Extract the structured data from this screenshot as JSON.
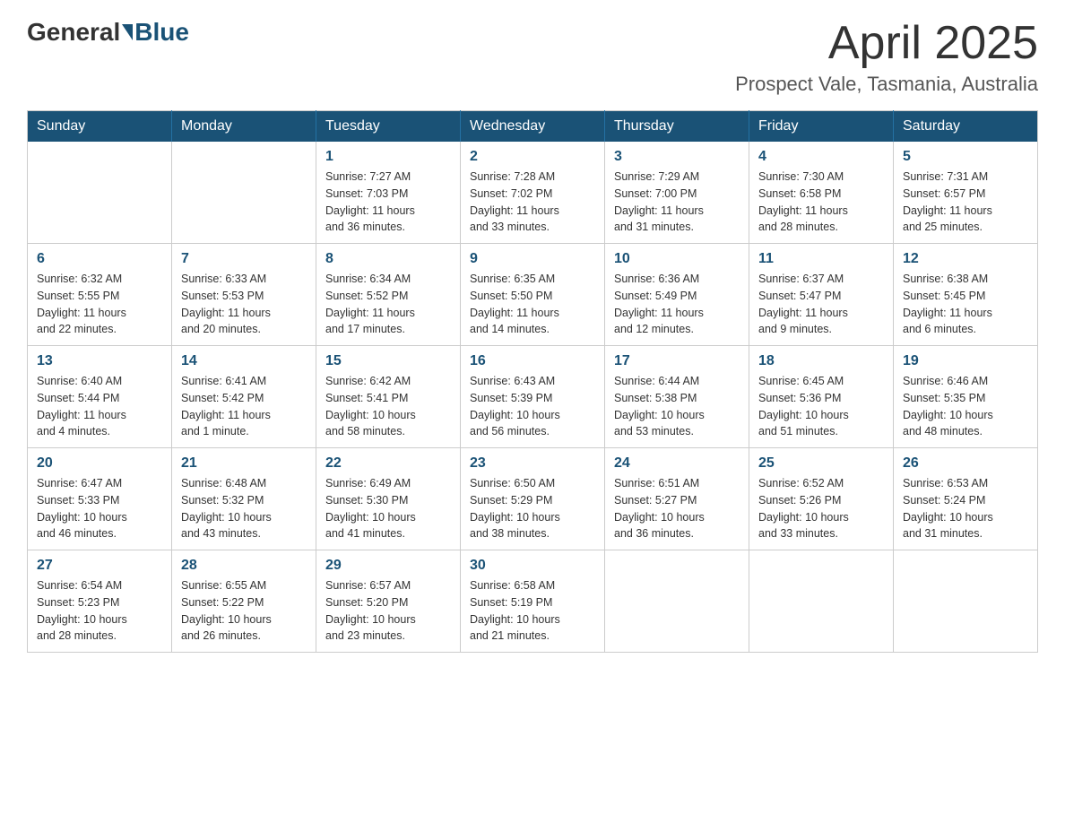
{
  "header": {
    "logo_general": "General",
    "logo_blue": "Blue",
    "month_title": "April 2025",
    "location": "Prospect Vale, Tasmania, Australia"
  },
  "days_of_week": [
    "Sunday",
    "Monday",
    "Tuesday",
    "Wednesday",
    "Thursday",
    "Friday",
    "Saturday"
  ],
  "weeks": [
    [
      {
        "day": "",
        "info": ""
      },
      {
        "day": "",
        "info": ""
      },
      {
        "day": "1",
        "info": "Sunrise: 7:27 AM\nSunset: 7:03 PM\nDaylight: 11 hours\nand 36 minutes."
      },
      {
        "day": "2",
        "info": "Sunrise: 7:28 AM\nSunset: 7:02 PM\nDaylight: 11 hours\nand 33 minutes."
      },
      {
        "day": "3",
        "info": "Sunrise: 7:29 AM\nSunset: 7:00 PM\nDaylight: 11 hours\nand 31 minutes."
      },
      {
        "day": "4",
        "info": "Sunrise: 7:30 AM\nSunset: 6:58 PM\nDaylight: 11 hours\nand 28 minutes."
      },
      {
        "day": "5",
        "info": "Sunrise: 7:31 AM\nSunset: 6:57 PM\nDaylight: 11 hours\nand 25 minutes."
      }
    ],
    [
      {
        "day": "6",
        "info": "Sunrise: 6:32 AM\nSunset: 5:55 PM\nDaylight: 11 hours\nand 22 minutes."
      },
      {
        "day": "7",
        "info": "Sunrise: 6:33 AM\nSunset: 5:53 PM\nDaylight: 11 hours\nand 20 minutes."
      },
      {
        "day": "8",
        "info": "Sunrise: 6:34 AM\nSunset: 5:52 PM\nDaylight: 11 hours\nand 17 minutes."
      },
      {
        "day": "9",
        "info": "Sunrise: 6:35 AM\nSunset: 5:50 PM\nDaylight: 11 hours\nand 14 minutes."
      },
      {
        "day": "10",
        "info": "Sunrise: 6:36 AM\nSunset: 5:49 PM\nDaylight: 11 hours\nand 12 minutes."
      },
      {
        "day": "11",
        "info": "Sunrise: 6:37 AM\nSunset: 5:47 PM\nDaylight: 11 hours\nand 9 minutes."
      },
      {
        "day": "12",
        "info": "Sunrise: 6:38 AM\nSunset: 5:45 PM\nDaylight: 11 hours\nand 6 minutes."
      }
    ],
    [
      {
        "day": "13",
        "info": "Sunrise: 6:40 AM\nSunset: 5:44 PM\nDaylight: 11 hours\nand 4 minutes."
      },
      {
        "day": "14",
        "info": "Sunrise: 6:41 AM\nSunset: 5:42 PM\nDaylight: 11 hours\nand 1 minute."
      },
      {
        "day": "15",
        "info": "Sunrise: 6:42 AM\nSunset: 5:41 PM\nDaylight: 10 hours\nand 58 minutes."
      },
      {
        "day": "16",
        "info": "Sunrise: 6:43 AM\nSunset: 5:39 PM\nDaylight: 10 hours\nand 56 minutes."
      },
      {
        "day": "17",
        "info": "Sunrise: 6:44 AM\nSunset: 5:38 PM\nDaylight: 10 hours\nand 53 minutes."
      },
      {
        "day": "18",
        "info": "Sunrise: 6:45 AM\nSunset: 5:36 PM\nDaylight: 10 hours\nand 51 minutes."
      },
      {
        "day": "19",
        "info": "Sunrise: 6:46 AM\nSunset: 5:35 PM\nDaylight: 10 hours\nand 48 minutes."
      }
    ],
    [
      {
        "day": "20",
        "info": "Sunrise: 6:47 AM\nSunset: 5:33 PM\nDaylight: 10 hours\nand 46 minutes."
      },
      {
        "day": "21",
        "info": "Sunrise: 6:48 AM\nSunset: 5:32 PM\nDaylight: 10 hours\nand 43 minutes."
      },
      {
        "day": "22",
        "info": "Sunrise: 6:49 AM\nSunset: 5:30 PM\nDaylight: 10 hours\nand 41 minutes."
      },
      {
        "day": "23",
        "info": "Sunrise: 6:50 AM\nSunset: 5:29 PM\nDaylight: 10 hours\nand 38 minutes."
      },
      {
        "day": "24",
        "info": "Sunrise: 6:51 AM\nSunset: 5:27 PM\nDaylight: 10 hours\nand 36 minutes."
      },
      {
        "day": "25",
        "info": "Sunrise: 6:52 AM\nSunset: 5:26 PM\nDaylight: 10 hours\nand 33 minutes."
      },
      {
        "day": "26",
        "info": "Sunrise: 6:53 AM\nSunset: 5:24 PM\nDaylight: 10 hours\nand 31 minutes."
      }
    ],
    [
      {
        "day": "27",
        "info": "Sunrise: 6:54 AM\nSunset: 5:23 PM\nDaylight: 10 hours\nand 28 minutes."
      },
      {
        "day": "28",
        "info": "Sunrise: 6:55 AM\nSunset: 5:22 PM\nDaylight: 10 hours\nand 26 minutes."
      },
      {
        "day": "29",
        "info": "Sunrise: 6:57 AM\nSunset: 5:20 PM\nDaylight: 10 hours\nand 23 minutes."
      },
      {
        "day": "30",
        "info": "Sunrise: 6:58 AM\nSunset: 5:19 PM\nDaylight: 10 hours\nand 21 minutes."
      },
      {
        "day": "",
        "info": ""
      },
      {
        "day": "",
        "info": ""
      },
      {
        "day": "",
        "info": ""
      }
    ]
  ]
}
